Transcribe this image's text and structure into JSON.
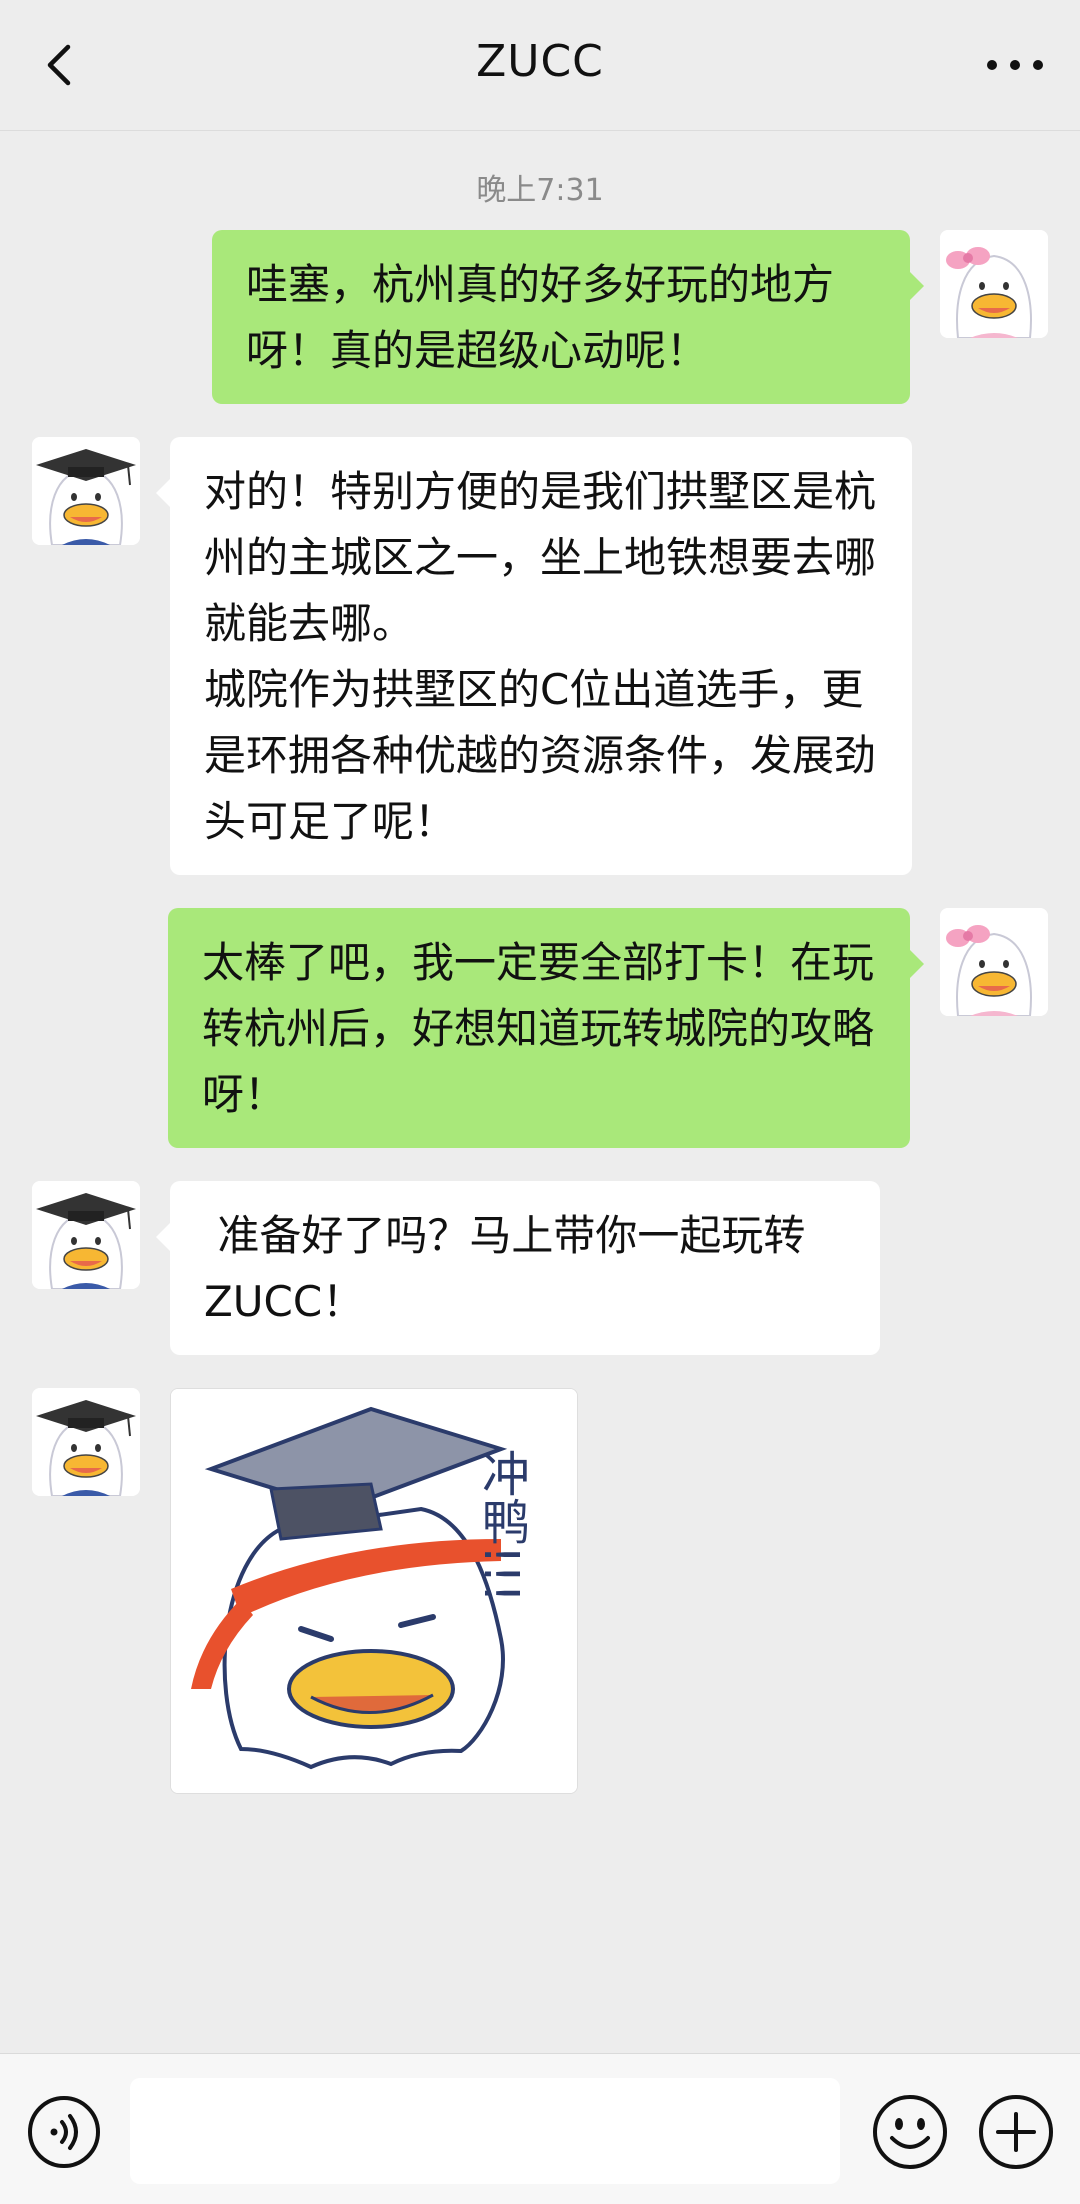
{
  "header": {
    "title": "ZUCC",
    "back_icon": "chevron-left-icon",
    "more_icon": "more-dots-icon"
  },
  "chat": {
    "timestamp": "晚上7:31",
    "messages": [
      {
        "from": "me",
        "text": "哇塞，杭州真的好多好玩的地方呀！真的是超级心动呢！"
      },
      {
        "from": "zucc",
        "text": "对的！特别方便的是我们拱墅区是杭州的主城区之一，坐上地铁想要去哪就能去哪。\n城院作为拱墅区的C位出道选手，更是环拥各种优越的资源条件，发展劲头可足了呢！"
      },
      {
        "from": "me",
        "text": "太棒了吧，我一定要全部打卡！在玩转杭州后，好想知道玩转城院的攻略呀！"
      },
      {
        "from": "zucc",
        "text": " 准备好了吗？马上带你一起玩转ZUCC！"
      },
      {
        "from": "zucc",
        "sticker_text": "冲鸭!!!"
      }
    ]
  },
  "input_bar": {
    "voice_icon": "voice-icon",
    "emoji_icon": "emoji-icon",
    "plus_icon": "plus-icon",
    "input_value": ""
  },
  "colors": {
    "background": "#ededed",
    "my_bubble": "#a9e87a",
    "their_bubble": "#ffffff"
  }
}
